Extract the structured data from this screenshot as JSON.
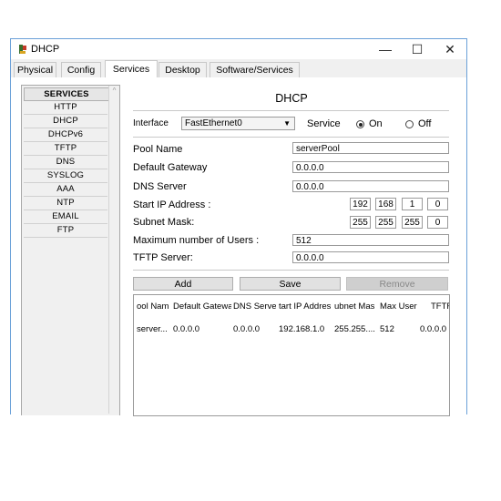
{
  "window": {
    "title": "DHCP",
    "controls": {
      "minimize": "—",
      "maximize": "☐",
      "close": "✕"
    }
  },
  "tabs": [
    "Physical",
    "Config",
    "Services",
    "Desktop",
    "Software/Services"
  ],
  "active_tab": "Services",
  "services": {
    "heading": "SERVICES",
    "items": [
      "HTTP",
      "DHCP",
      "DHCPv6",
      "TFTP",
      "DNS",
      "SYSLOG",
      "AAA",
      "NTP",
      "EMAIL",
      "FTP"
    ],
    "scroll_up": "^"
  },
  "dhcp": {
    "title": "DHCP",
    "interface_label": "Interface",
    "interface_value": "FastEthernet0",
    "service_label": "Service",
    "service_on": "On",
    "service_off": "Off",
    "service_state": "On",
    "pool_name_label": "Pool Name",
    "pool_name": "serverPool",
    "gateway_label": "Default Gateway",
    "gateway": "0.0.0.0",
    "dns_label": "DNS Server",
    "dns": "0.0.0.0",
    "start_ip_label": "Start IP Address :",
    "start_ip": [
      "192",
      "168",
      "1",
      "0"
    ],
    "subnet_label": "Subnet Mask:",
    "subnet": [
      "255",
      "255",
      "255",
      "0"
    ],
    "max_users_label": "Maximum number of Users :",
    "max_users": "512",
    "tftp_label": "TFTP Server:",
    "tftp": "0.0.0.0",
    "buttons": {
      "add": "Add",
      "save": "Save",
      "remove": "Remove"
    },
    "table": {
      "headers": [
        "ool Nam",
        "Default Gatewa",
        "DNS Server",
        "tart IP Addres",
        "ubnet Mas",
        "Max User",
        "TFTF"
      ],
      "rows": [
        [
          "server...",
          "0.0.0.0",
          "0.0.0.0",
          "192.168.1.0",
          "255.255....",
          "512",
          "0.0.0.0"
        ]
      ]
    }
  }
}
